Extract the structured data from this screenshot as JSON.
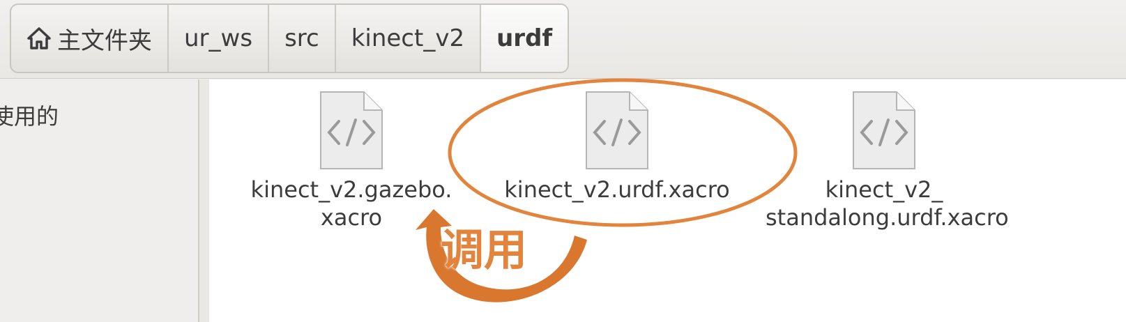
{
  "pathbar": {
    "crumbs": [
      {
        "label": "主文件夹",
        "icon": "home-icon"
      },
      {
        "label": "ur_ws"
      },
      {
        "label": "src"
      },
      {
        "label": "kinect_v2"
      },
      {
        "label": "urdf",
        "active": true
      }
    ]
  },
  "sidebar": {
    "items": [
      {
        "label": "使用的"
      }
    ]
  },
  "files": [
    {
      "name": "kinect_v2.gazebo.\nxacro",
      "icon": "xml-file-icon"
    },
    {
      "name": "kinect_v2.urdf.xacro",
      "icon": "xml-file-icon",
      "highlighted": true
    },
    {
      "name": "kinect_v2_\nstandalong.urdf.xacro",
      "icon": "xml-file-icon"
    }
  ],
  "annotation": {
    "label": "调用",
    "color": "#e3843d"
  }
}
